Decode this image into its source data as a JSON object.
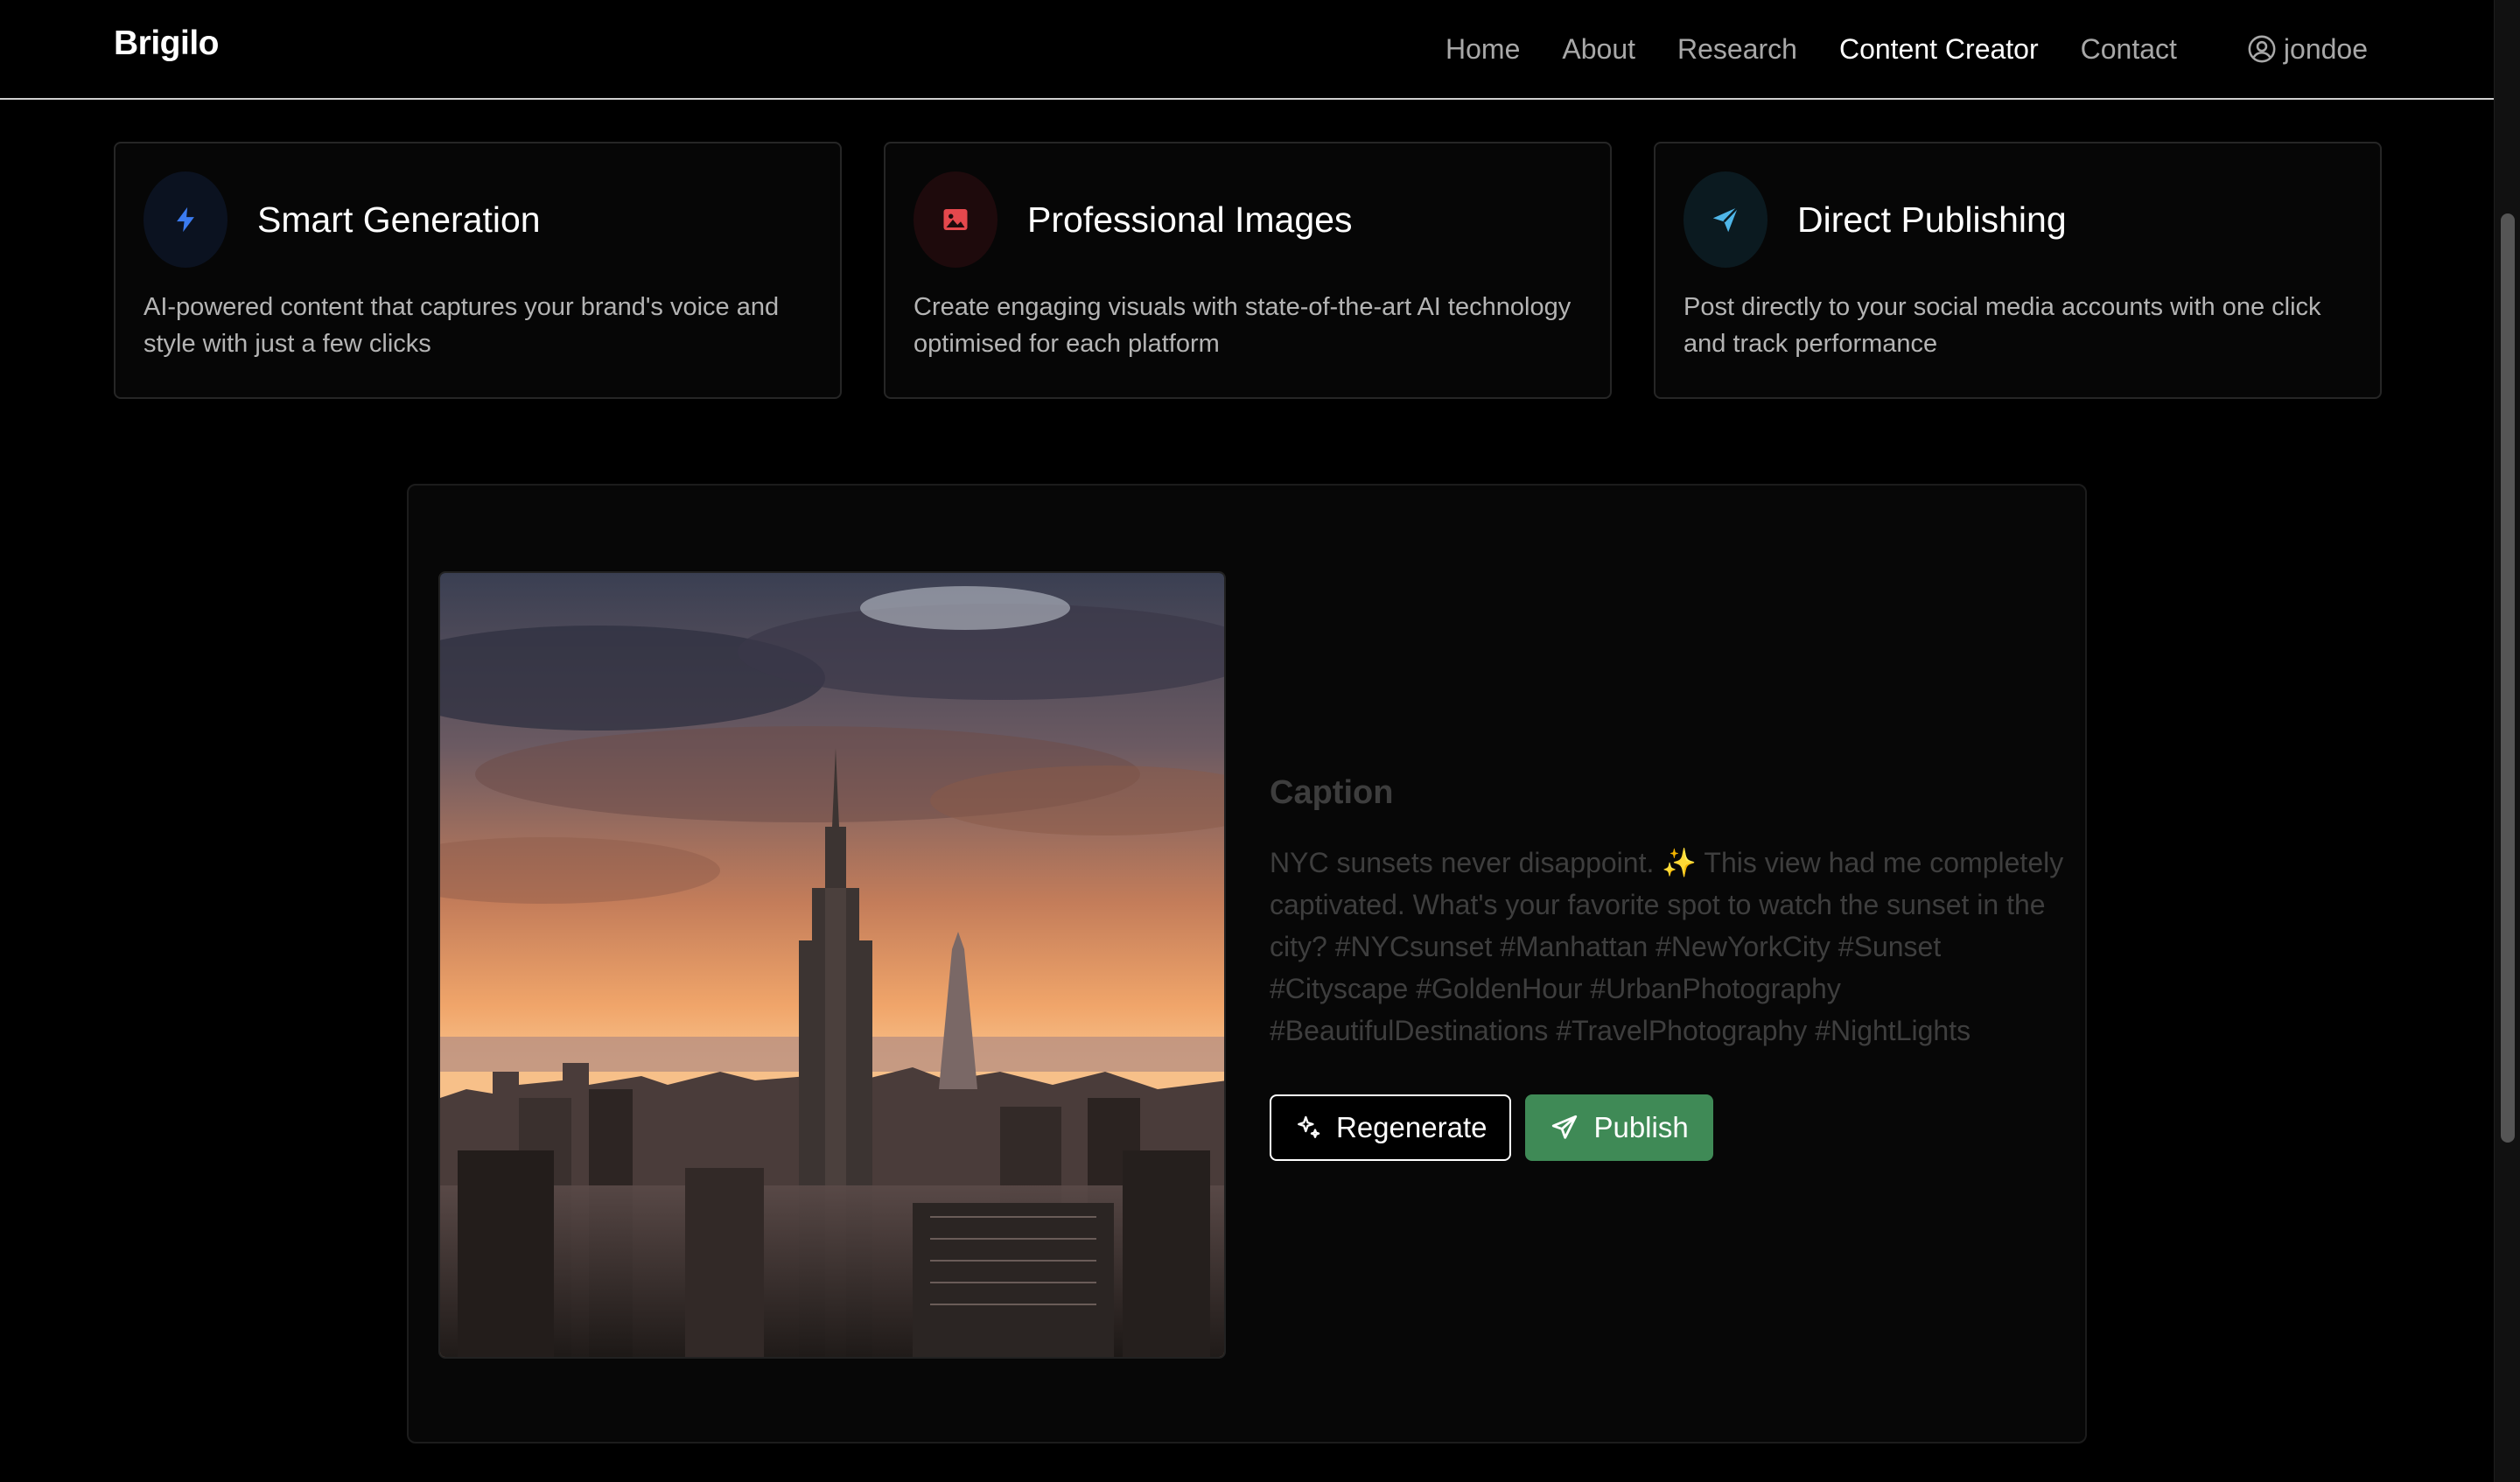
{
  "nav": {
    "brand": "Brigilo",
    "links": [
      "Home",
      "About",
      "Research",
      "Content Creator",
      "Contact"
    ],
    "active": "Content Creator",
    "user": "jondoe"
  },
  "features": [
    {
      "icon": "lightning-icon",
      "title": "Smart Generation",
      "description": "AI-powered content that captures your brand's voice and style with just a few clicks",
      "accent": "#3b7bf0"
    },
    {
      "icon": "image-icon",
      "title": "Professional Images",
      "description": "Create engaging visuals with state-of-the-art AI technology optimised for each platform",
      "accent": "#e5484d"
    },
    {
      "icon": "send-icon",
      "title": "Direct Publishing",
      "description": "Post directly to your social media accounts with one click and track performance",
      "accent": "#4fb6e8"
    }
  ],
  "generated": {
    "image_icon": "city-skyline-photo",
    "caption_label": "Caption",
    "caption_text": "NYC sunsets never disappoint. ✨ This view had me completely captivated. What's your favorite spot to watch the sunset in the city? #NYCsunset #Manhattan #NewYorkCity #Sunset #Cityscape #GoldenHour #UrbanPhotography #BeautifulDestinations #TravelPhotography #NightLights",
    "regenerate_label": "Regenerate",
    "publish_label": "Publish"
  },
  "colors": {
    "publish": "#3f8a56",
    "background": "#000000"
  }
}
